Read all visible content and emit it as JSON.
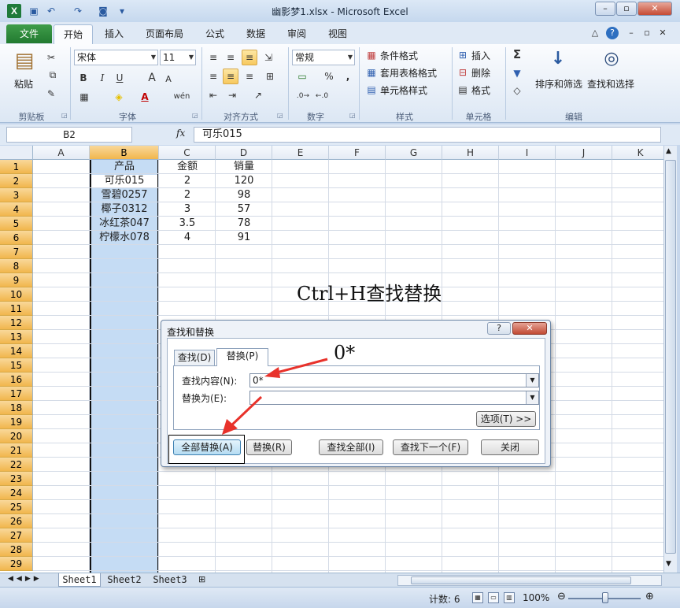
{
  "window": {
    "title": "幽影梦1.xlsx - Microsoft Excel",
    "app_icon": "X"
  },
  "ribbon_tabs": [
    "开始",
    "插入",
    "页面布局",
    "公式",
    "数据",
    "审阅",
    "视图"
  ],
  "file_tab": "文件",
  "ribbon": {
    "clipboard": {
      "paste": "粘贴",
      "label": "剪贴板"
    },
    "font": {
      "name": "宋体",
      "size": "11",
      "label": "字体",
      "bold": "B",
      "italic": "I",
      "underline": "U",
      "grow": "A",
      "shrink": "A",
      "color_a": "A",
      "wen": "wén"
    },
    "alignment": {
      "label": "对齐方式"
    },
    "number": {
      "format": "常规",
      "label": "数字",
      "percent": "%",
      "comma": ","
    },
    "styles": {
      "conditional": "条件格式",
      "table": "套用表格格式",
      "cell": "单元格样式",
      "label": "样式"
    },
    "cells": {
      "insert": "插入",
      "delete": "删除",
      "format": "格式",
      "label": "单元格"
    },
    "editing": {
      "sort": "排序和筛选",
      "find": "查找和选择",
      "label": "编辑",
      "sigma": "Σ"
    }
  },
  "formula_bar": {
    "name_box": "B2",
    "fx": "fx",
    "content": "可乐015"
  },
  "columns": [
    "A",
    "B",
    "C",
    "D",
    "E",
    "F",
    "G",
    "H",
    "I",
    "J",
    "K"
  ],
  "rows": [
    "1",
    "2",
    "3",
    "4",
    "5",
    "6",
    "7",
    "8",
    "9",
    "10",
    "11",
    "12",
    "13",
    "14",
    "15",
    "16",
    "17",
    "18",
    "19",
    "20",
    "21",
    "22",
    "23",
    "24",
    "25",
    "26",
    "27",
    "28",
    "29"
  ],
  "table": {
    "headers": [
      "产品",
      "金额",
      "销量"
    ],
    "rows": [
      [
        "可乐015",
        "2",
        "120"
      ],
      [
        "雪碧0257",
        "2",
        "98"
      ],
      [
        "椰子0312",
        "3",
        "57"
      ],
      [
        "冰红茶047",
        "3.5",
        "78"
      ],
      [
        "柠檬水078",
        "4",
        "91"
      ]
    ]
  },
  "annotation_main": "Ctrl+H查找替换",
  "annotation_pattern": "0*",
  "dialog": {
    "title": "查找和替换",
    "help": "?",
    "tab_find": "查找(D)",
    "tab_replace": "替换(P)",
    "find_label": "查找内容(N):",
    "find_value": "0*",
    "replace_label": "替换为(E):",
    "replace_value": "",
    "options": "选项(T) >>",
    "replace_all": "全部替换(A)",
    "replace": "替换(R)",
    "find_all": "查找全部(I)",
    "find_next": "查找下一个(F)",
    "close": "关闭"
  },
  "sheets": [
    "Sheet1",
    "Sheet2",
    "Sheet3"
  ],
  "status": {
    "count": "计数: 6",
    "zoom": "100%"
  },
  "colors": {
    "accent_green": "#227a30",
    "selection_blue": "#c5dcf4",
    "header_orange": "#f1b64d",
    "arrow_red": "#e8322b"
  }
}
